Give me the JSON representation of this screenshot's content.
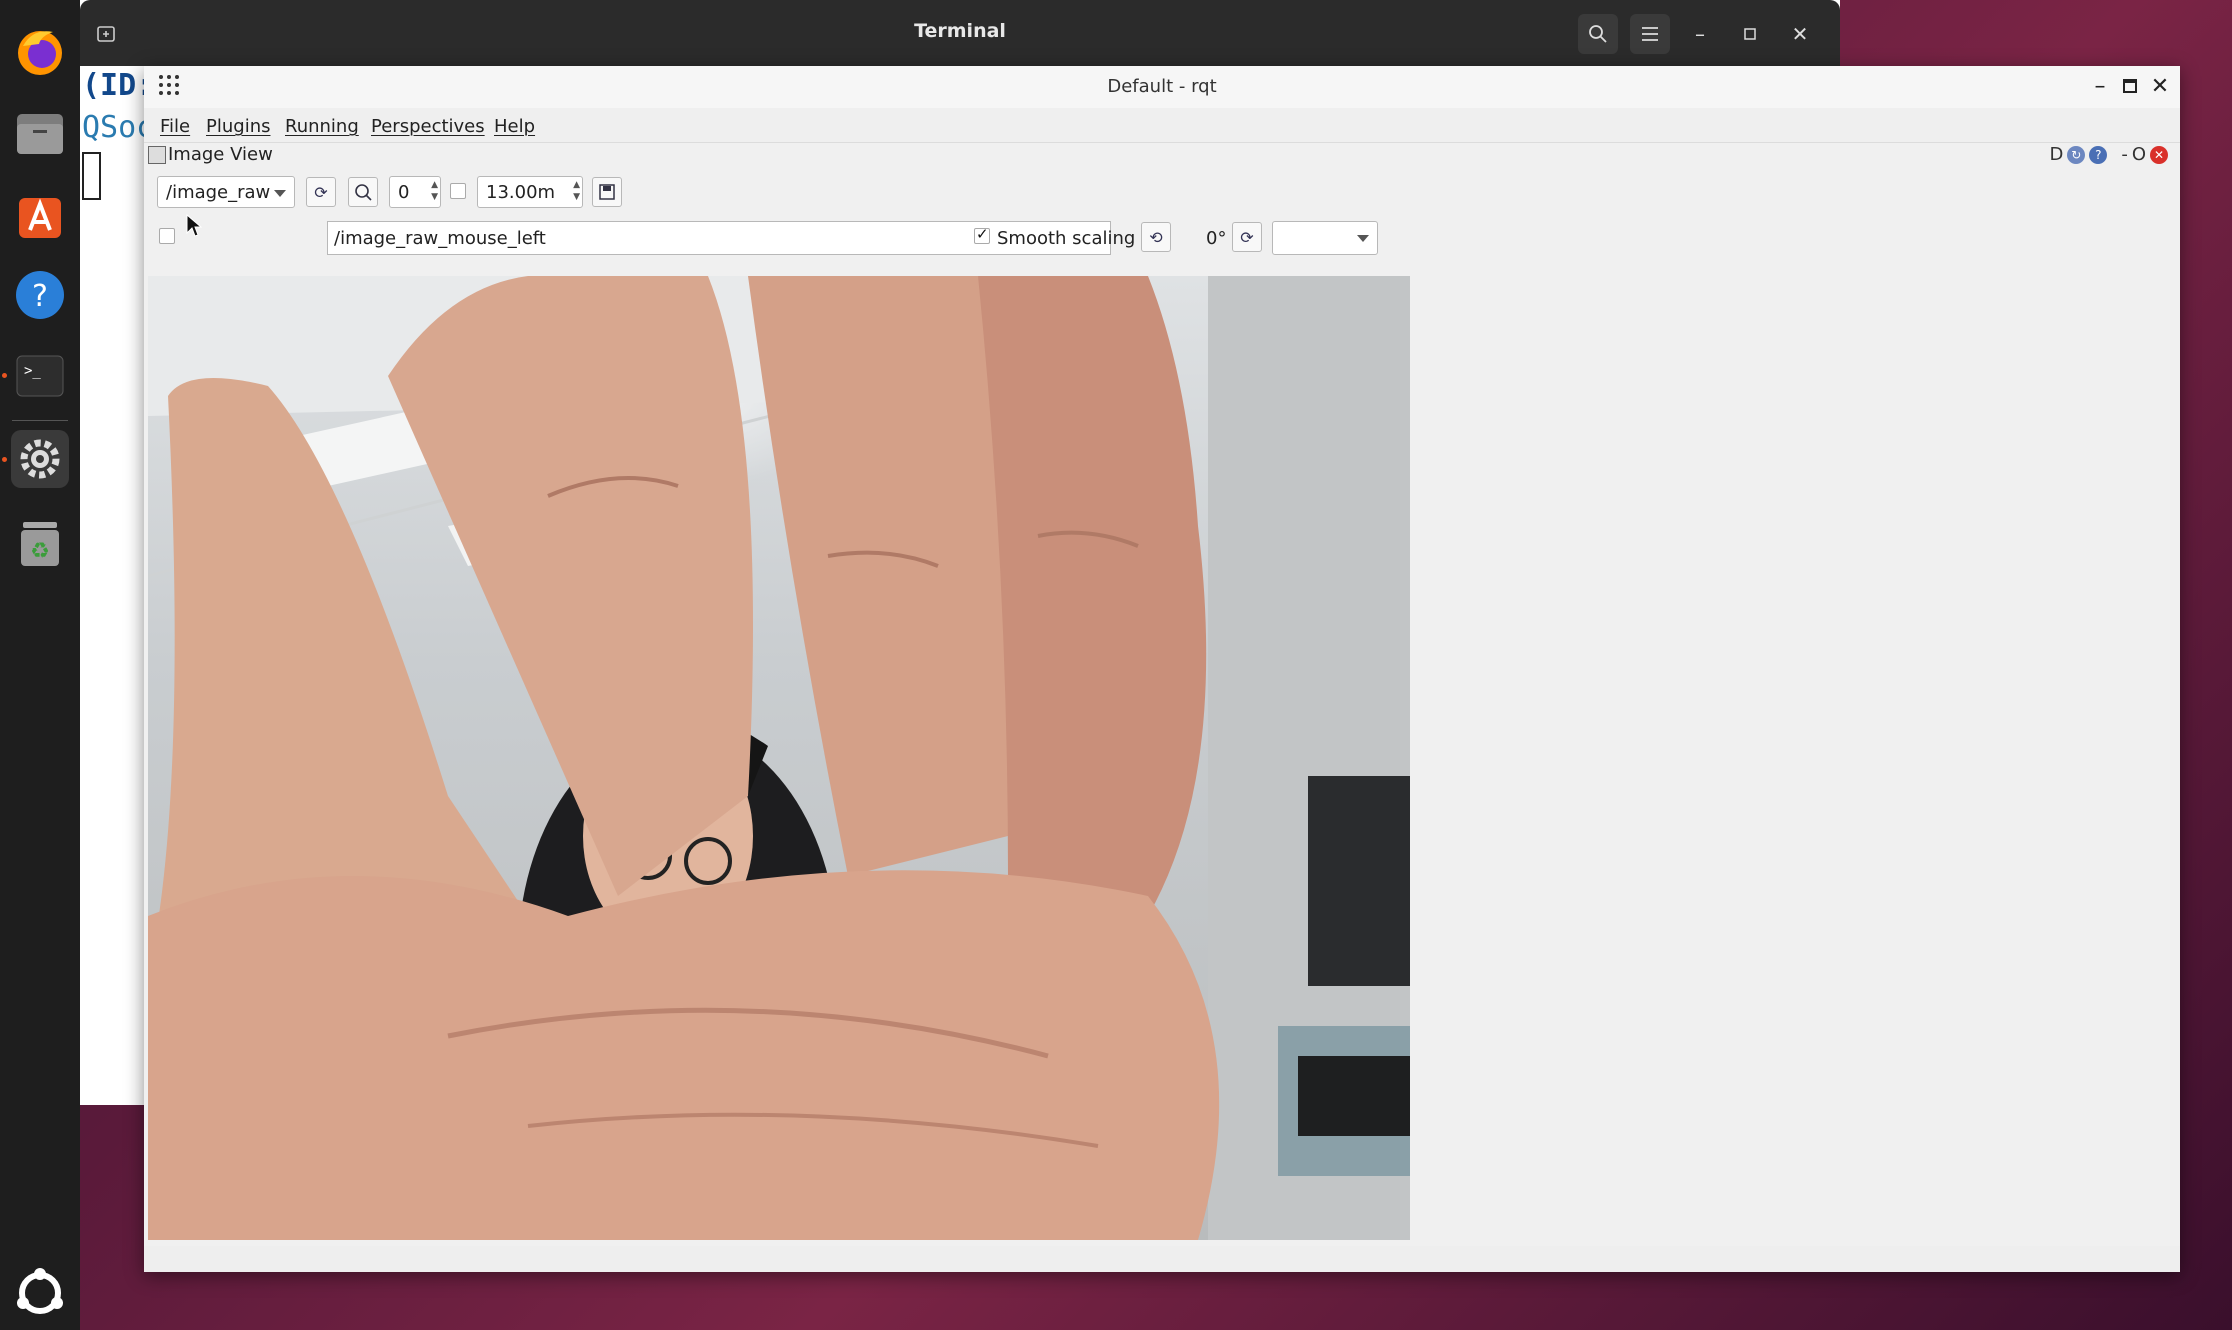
{
  "terminal": {
    "title": "Terminal",
    "line1": "(ID:",
    "line2": "QSoc"
  },
  "dock": {
    "items": [
      "firefox-icon",
      "files-icon",
      "app-center-icon",
      "help-icon",
      "terminal-icon",
      "settings-icon",
      "trash-icon",
      "show-apps-icon"
    ]
  },
  "rqt": {
    "title": "Default - rqt",
    "menu": [
      "File",
      "Plugins",
      "Running",
      "Perspectives",
      "Help"
    ],
    "plugin": {
      "title": "Image View",
      "controls_text": "D",
      "minimize": "-",
      "float": "O"
    },
    "toolbar": {
      "topic": "/image_raw",
      "zoom_value": "0",
      "max_value": "13.00m",
      "mouse_topic": "/image_raw_mouse_left",
      "smooth_scaling_label": "Smooth scaling",
      "smooth_scaling_checked": true,
      "dynamic_range_checked": false,
      "publish_mouse_checked": false,
      "rotation": "0°",
      "color_scheme": ""
    }
  },
  "colors": {
    "accent": "#e95420",
    "terminal_titlebar": "#2b2b2b",
    "desktop": "#5a1a3a"
  }
}
